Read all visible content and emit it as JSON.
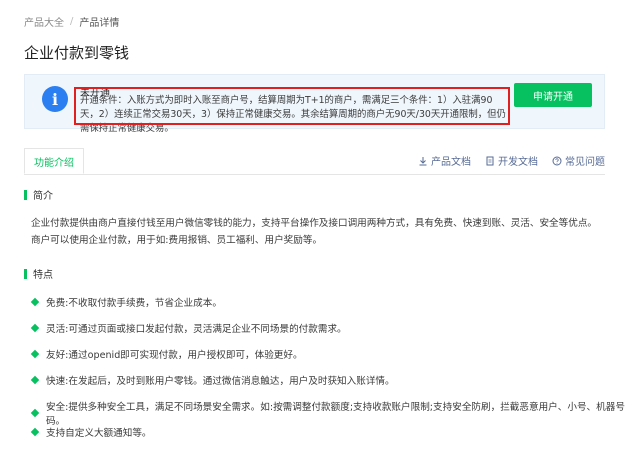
{
  "breadcrumb": {
    "root": "产品大全",
    "separator": "/",
    "current": "产品详情"
  },
  "page_title": "企业付款到零钱",
  "notice": {
    "icon": "info-icon",
    "status": "未开通",
    "conditions": "开通条件：入账方式为即时入账至商户号，结算周期为T+1的商户，需满足三个条件：1）入驻满90天，2）连续正常交易30天，3）保持正常健康交易。其余结算周期的商户无90天/30天开通限制，但仍需保持正常健康交易。",
    "apply_label": "申请开通"
  },
  "tabs": {
    "active": "功能介绍"
  },
  "links": {
    "product_doc": "产品文档",
    "dev_doc": "开发文档",
    "faq": "常见问题"
  },
  "intro": {
    "heading": "简介",
    "text": "企业付款提供由商户直接付钱至用户微信零钱的能力，支持平台操作及接口调用两种方式，具有免费、快速到账、灵活、安全等优点。商户可以使用企业付款，用于如:费用报销、员工福利、用户奖励等。"
  },
  "features": {
    "heading": "特点",
    "items": [
      "免费:不收取付款手续费，节省企业成本。",
      "灵活:可通过页面或接口发起付款，灵活满足企业不同场景的付款需求。",
      "友好:通过openid即可实现付款，用户授权即可，体验更好。",
      "快速:在发起后，及时到账用户零钱。通过微信消息触达，用户及时获知入账详情。",
      "安全:提供多种安全工具，满足不同场景安全需求。如:按需调整付款额度;支持收款账户限制;支持安全防刷，拦截恶意用户、小号、机器号码。",
      "支持自定义大额通知等。"
    ]
  },
  "colors": {
    "accent": "#07c160",
    "info": "#2b7ff0",
    "highlight": "#e02020",
    "link": "#576b95"
  }
}
